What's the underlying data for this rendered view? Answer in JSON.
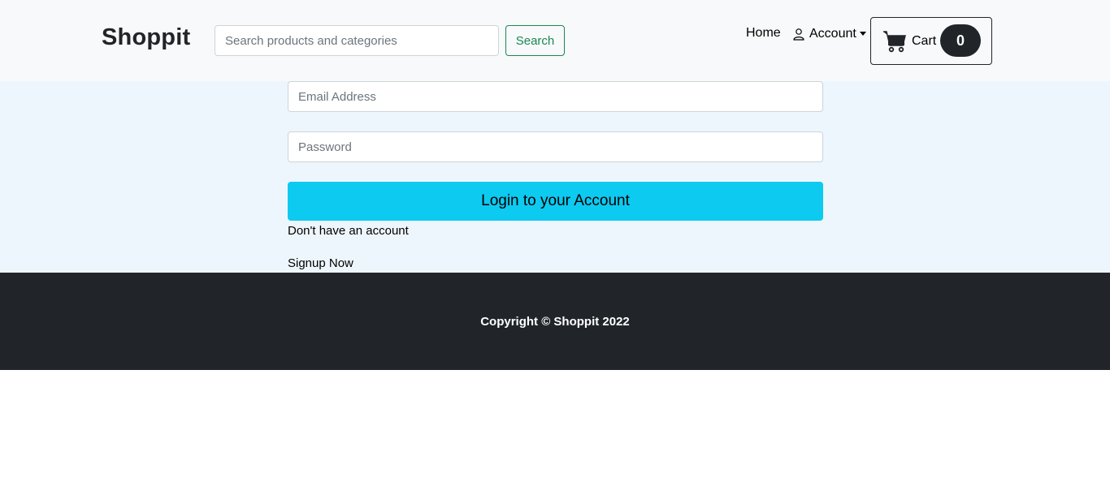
{
  "navbar": {
    "brand": "Shoppit",
    "search": {
      "placeholder": "Search products and categories",
      "value": "",
      "button_label": "Search"
    },
    "links": {
      "home": "Home",
      "account": "Account"
    },
    "cart": {
      "label": "Cart",
      "count": "0",
      "icon": "shopping-cart-icon"
    }
  },
  "login_form": {
    "email_placeholder": "Email Address",
    "email_value": "",
    "password_placeholder": "Password",
    "password_value": "",
    "submit_label": "Login to your Account",
    "no_account_text": "Don't have an account",
    "signup_label": "Signup Now"
  },
  "footer": {
    "copyright": "Copyright © Shoppit 2022"
  },
  "colors": {
    "navbar_bg": "#f8f9fa",
    "main_bg": "#eef6fd",
    "footer_bg": "#212529",
    "search_accent": "#198754",
    "login_button": "#0dcaf0",
    "cart_badge": "#212529"
  }
}
